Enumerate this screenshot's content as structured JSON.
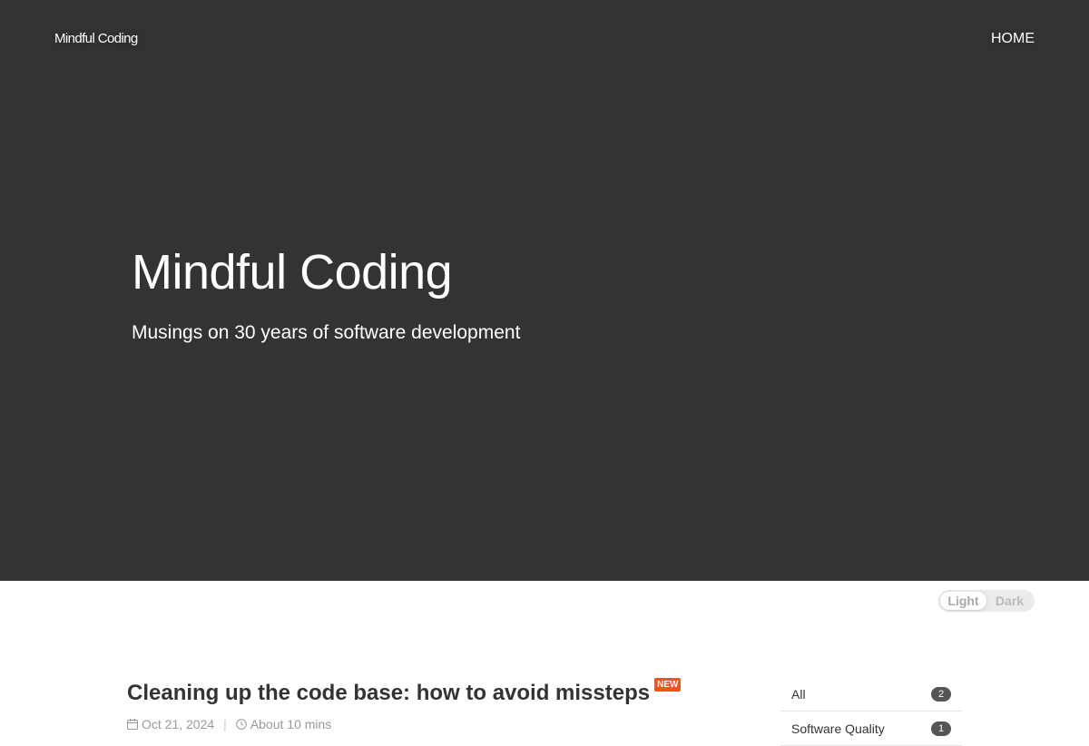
{
  "header": {
    "brand": "Mindful Coding",
    "nav_home": "HOME"
  },
  "hero": {
    "title": "Mindful Coding",
    "subtitle": "Musings on 30 years of software development"
  },
  "theme_toggle": {
    "light": "Light",
    "dark": "Dark",
    "selected": "Light"
  },
  "post": {
    "title": "Cleaning up the code base: how to avoid missteps",
    "badge": "NEW",
    "date": "Oct 21, 2024",
    "read_time": "About 10 mins",
    "date_icon": "calendar-icon",
    "time_icon": "clock-icon"
  },
  "categories": {
    "items": [
      {
        "label": "All",
        "count": "2"
      },
      {
        "label": "Software Quality",
        "count": "1"
      }
    ]
  },
  "colors": {
    "hero_bg": "#333333",
    "badge": "#f0541f",
    "count_badge": "#555555"
  }
}
